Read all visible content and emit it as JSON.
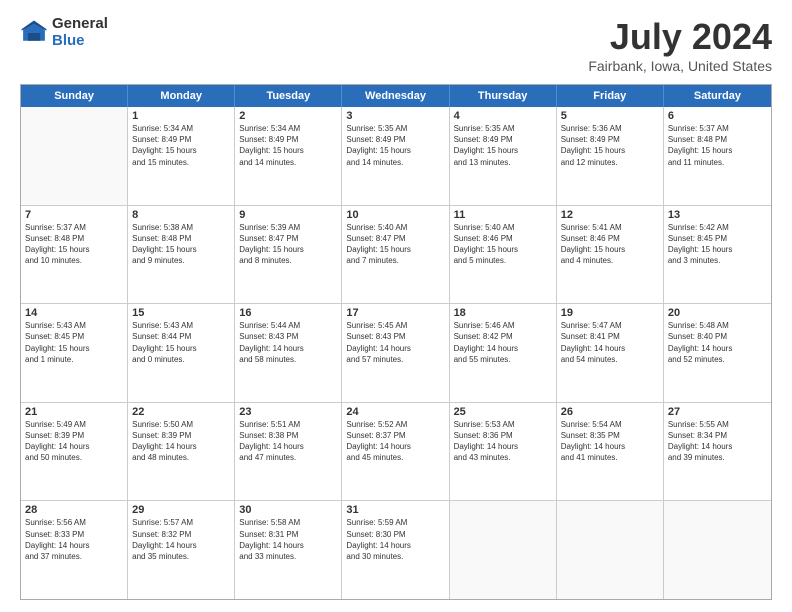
{
  "logo": {
    "general": "General",
    "blue": "Blue"
  },
  "header": {
    "title": "July 2024",
    "subtitle": "Fairbank, Iowa, United States"
  },
  "days": [
    "Sunday",
    "Monday",
    "Tuesday",
    "Wednesday",
    "Thursday",
    "Friday",
    "Saturday"
  ],
  "weeks": [
    [
      {
        "day": "",
        "content": ""
      },
      {
        "day": "1",
        "content": "Sunrise: 5:34 AM\nSunset: 8:49 PM\nDaylight: 15 hours\nand 15 minutes."
      },
      {
        "day": "2",
        "content": "Sunrise: 5:34 AM\nSunset: 8:49 PM\nDaylight: 15 hours\nand 14 minutes."
      },
      {
        "day": "3",
        "content": "Sunrise: 5:35 AM\nSunset: 8:49 PM\nDaylight: 15 hours\nand 14 minutes."
      },
      {
        "day": "4",
        "content": "Sunrise: 5:35 AM\nSunset: 8:49 PM\nDaylight: 15 hours\nand 13 minutes."
      },
      {
        "day": "5",
        "content": "Sunrise: 5:36 AM\nSunset: 8:49 PM\nDaylight: 15 hours\nand 12 minutes."
      },
      {
        "day": "6",
        "content": "Sunrise: 5:37 AM\nSunset: 8:48 PM\nDaylight: 15 hours\nand 11 minutes."
      }
    ],
    [
      {
        "day": "7",
        "content": "Sunrise: 5:37 AM\nSunset: 8:48 PM\nDaylight: 15 hours\nand 10 minutes."
      },
      {
        "day": "8",
        "content": "Sunrise: 5:38 AM\nSunset: 8:48 PM\nDaylight: 15 hours\nand 9 minutes."
      },
      {
        "day": "9",
        "content": "Sunrise: 5:39 AM\nSunset: 8:47 PM\nDaylight: 15 hours\nand 8 minutes."
      },
      {
        "day": "10",
        "content": "Sunrise: 5:40 AM\nSunset: 8:47 PM\nDaylight: 15 hours\nand 7 minutes."
      },
      {
        "day": "11",
        "content": "Sunrise: 5:40 AM\nSunset: 8:46 PM\nDaylight: 15 hours\nand 5 minutes."
      },
      {
        "day": "12",
        "content": "Sunrise: 5:41 AM\nSunset: 8:46 PM\nDaylight: 15 hours\nand 4 minutes."
      },
      {
        "day": "13",
        "content": "Sunrise: 5:42 AM\nSunset: 8:45 PM\nDaylight: 15 hours\nand 3 minutes."
      }
    ],
    [
      {
        "day": "14",
        "content": "Sunrise: 5:43 AM\nSunset: 8:45 PM\nDaylight: 15 hours\nand 1 minute."
      },
      {
        "day": "15",
        "content": "Sunrise: 5:43 AM\nSunset: 8:44 PM\nDaylight: 15 hours\nand 0 minutes."
      },
      {
        "day": "16",
        "content": "Sunrise: 5:44 AM\nSunset: 8:43 PM\nDaylight: 14 hours\nand 58 minutes."
      },
      {
        "day": "17",
        "content": "Sunrise: 5:45 AM\nSunset: 8:43 PM\nDaylight: 14 hours\nand 57 minutes."
      },
      {
        "day": "18",
        "content": "Sunrise: 5:46 AM\nSunset: 8:42 PM\nDaylight: 14 hours\nand 55 minutes."
      },
      {
        "day": "19",
        "content": "Sunrise: 5:47 AM\nSunset: 8:41 PM\nDaylight: 14 hours\nand 54 minutes."
      },
      {
        "day": "20",
        "content": "Sunrise: 5:48 AM\nSunset: 8:40 PM\nDaylight: 14 hours\nand 52 minutes."
      }
    ],
    [
      {
        "day": "21",
        "content": "Sunrise: 5:49 AM\nSunset: 8:39 PM\nDaylight: 14 hours\nand 50 minutes."
      },
      {
        "day": "22",
        "content": "Sunrise: 5:50 AM\nSunset: 8:39 PM\nDaylight: 14 hours\nand 48 minutes."
      },
      {
        "day": "23",
        "content": "Sunrise: 5:51 AM\nSunset: 8:38 PM\nDaylight: 14 hours\nand 47 minutes."
      },
      {
        "day": "24",
        "content": "Sunrise: 5:52 AM\nSunset: 8:37 PM\nDaylight: 14 hours\nand 45 minutes."
      },
      {
        "day": "25",
        "content": "Sunrise: 5:53 AM\nSunset: 8:36 PM\nDaylight: 14 hours\nand 43 minutes."
      },
      {
        "day": "26",
        "content": "Sunrise: 5:54 AM\nSunset: 8:35 PM\nDaylight: 14 hours\nand 41 minutes."
      },
      {
        "day": "27",
        "content": "Sunrise: 5:55 AM\nSunset: 8:34 PM\nDaylight: 14 hours\nand 39 minutes."
      }
    ],
    [
      {
        "day": "28",
        "content": "Sunrise: 5:56 AM\nSunset: 8:33 PM\nDaylight: 14 hours\nand 37 minutes."
      },
      {
        "day": "29",
        "content": "Sunrise: 5:57 AM\nSunset: 8:32 PM\nDaylight: 14 hours\nand 35 minutes."
      },
      {
        "day": "30",
        "content": "Sunrise: 5:58 AM\nSunset: 8:31 PM\nDaylight: 14 hours\nand 33 minutes."
      },
      {
        "day": "31",
        "content": "Sunrise: 5:59 AM\nSunset: 8:30 PM\nDaylight: 14 hours\nand 30 minutes."
      },
      {
        "day": "",
        "content": ""
      },
      {
        "day": "",
        "content": ""
      },
      {
        "day": "",
        "content": ""
      }
    ]
  ]
}
